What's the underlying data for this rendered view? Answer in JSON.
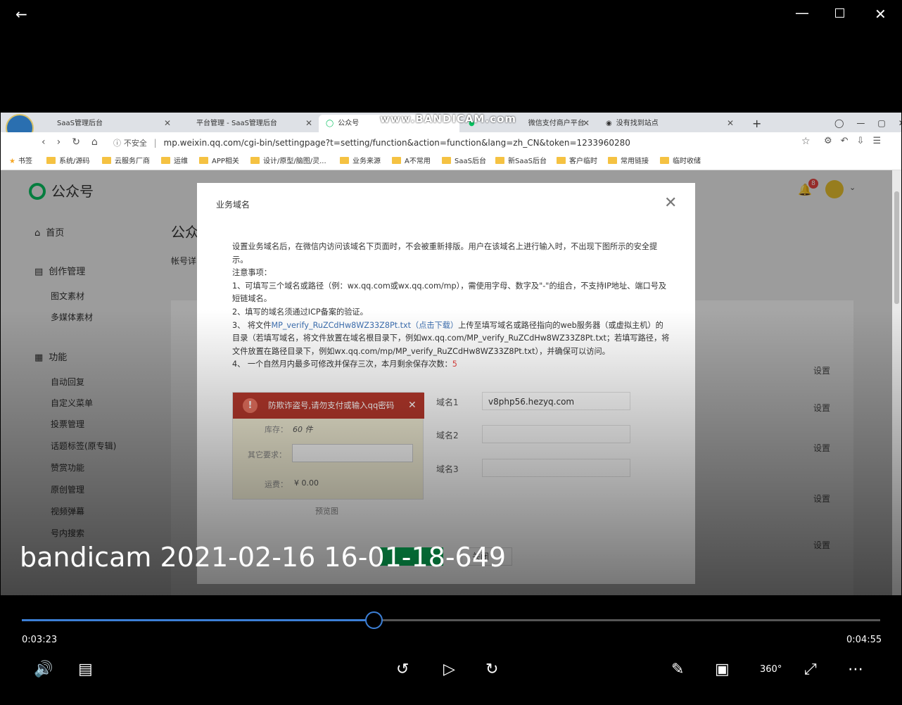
{
  "player": {
    "video_title": "bandicam 2021-02-16 16-01-18-649",
    "watermark": "www.BANDICAM.com",
    "current_time": "0:03:23",
    "total_time": "0:04:55",
    "progress_fraction": 0.41,
    "accent_color": "#3c7fd6"
  },
  "browser": {
    "tabs": [
      {
        "label": "SaaS管理后台"
      },
      {
        "label": "平台管理 - SaaS管理后台"
      },
      {
        "label": "公众号"
      },
      {
        "label": "微信支付商户平台"
      },
      {
        "label": "没有找到站点"
      }
    ],
    "insecure_label": "不安全",
    "url": "mp.weixin.qq.com/cgi-bin/settingpage?t=setting/function&action=function&lang=zh_CN&token=1233960280",
    "bookmarks": [
      "书签",
      "系统/源码",
      "云服务厂商",
      "运维",
      "APP相关",
      "设计/原型/脑图/灵...",
      "业务来源",
      "A不常用",
      "SaaS后台",
      "新SaaS后台",
      "客户临时",
      "常用链接",
      "临时收储"
    ]
  },
  "page": {
    "logo_text": "公众号",
    "notification_count": "8",
    "side_home": "首页",
    "side_create": "创作管理",
    "side_create_items": [
      "图文素材",
      "多媒体素材"
    ],
    "side_function": "功能",
    "side_function_items": [
      "自动回复",
      "自定义菜单",
      "投票管理",
      "话题标签(原专辑)",
      "赞赏功能",
      "原创管理",
      "视频弹幕",
      "号内搜索"
    ],
    "heading_partial": "公众",
    "tab_partial": "帐号详",
    "set_label": "设置"
  },
  "dialog": {
    "title": "业务域名",
    "intro": "设置业务域名后，在微信内访问该域名下页面时，不会被重新排版。用户在该域名上进行输入时，不出现下图所示的安全提示。",
    "notes_title": "注意事项：",
    "note1": "1、可填写三个域名或路径（例：wx.qq.com或wx.qq.com/mp），需使用字母、数字及\"-\"的组合，不支持IP地址、端口号及短链域名。",
    "note2": "2、填写的域名须通过ICP备案的验证。",
    "note3_pre": "3、 将文件",
    "note3_link": "MP_verify_RuZCdHw8WZ33Z8Pt.txt（点击下载）",
    "note3_post": "上传至填写域名或路径指向的web服务器（或虚拟主机）的目录（若填写域名，将文件放置在域名根目录下，例如wx.qq.com/MP_verify_RuZCdHw8WZ33Z8Pt.txt；若填写路径，将文件放置在路径目录下，例如wx.qq.com/mp/MP_verify_RuZCdHw8WZ33Z8Pt.txt），并确保可以访问。",
    "note4_pre": "4、 一个自然月内最多可修改并保存三次，本月剩余保存次数：",
    "note4_count": "5",
    "warning_text": "防欺诈盗号,请勿支付或输入qq密码",
    "stock_label": "库存：",
    "stock_value": "60 件",
    "other_label": "其它要求：",
    "freight_label": "运费：",
    "freight_value": "¥ 0.00",
    "preview_label": "预览图",
    "domain1_label": "域名1",
    "domain1_value": "v8php56.hezyq.com",
    "domain2_label": "域名2",
    "domain2_value": "",
    "domain3_label": "域名3",
    "domain3_value": "",
    "close_button": "关闭"
  }
}
